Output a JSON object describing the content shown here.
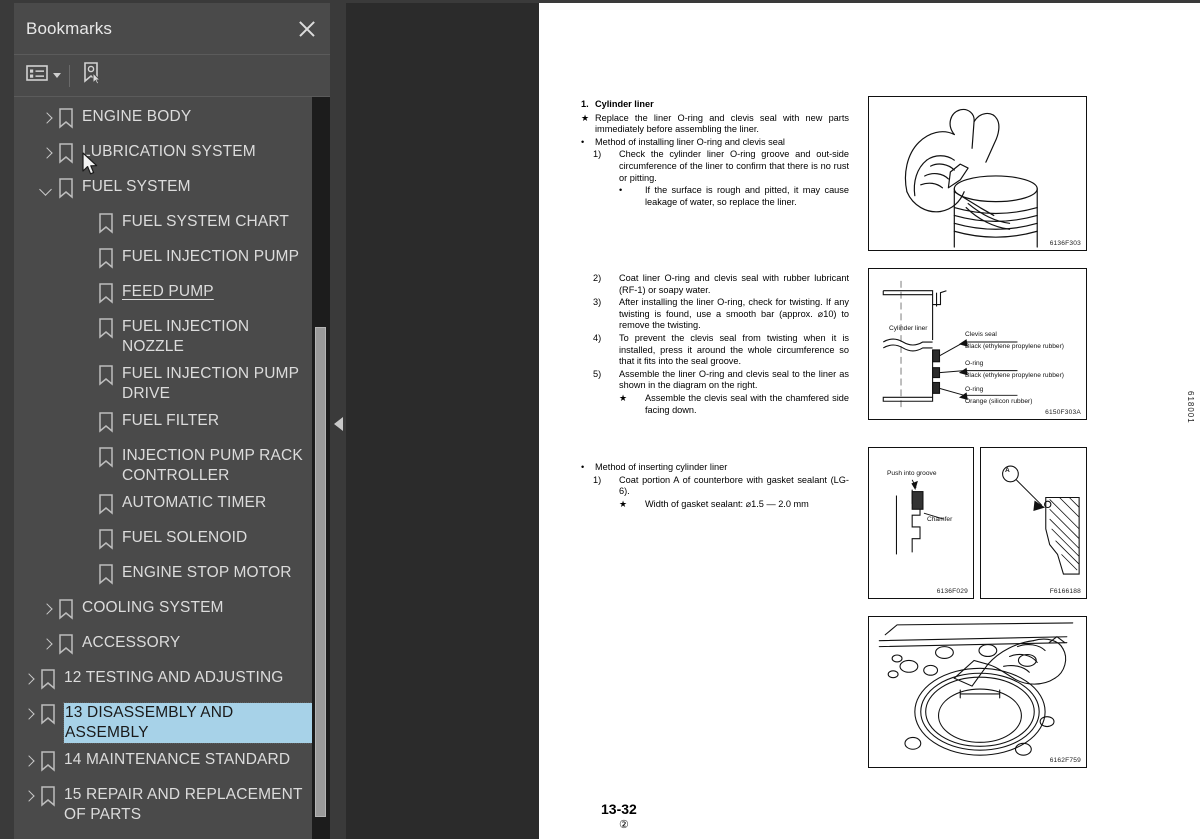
{
  "panel": {
    "title": "Bookmarks",
    "close_icon": "close-icon",
    "toolbar": {
      "options_icon": "list-options-icon",
      "chevron_icon": "chevron-down-icon",
      "new_bookmark_icon": "new-bookmark-icon"
    }
  },
  "tree": [
    {
      "label": "ENGINE BODY",
      "level": 0,
      "twisty": "right",
      "state": "normal"
    },
    {
      "label": "LUBRICATION SYSTEM",
      "level": 0,
      "twisty": "right",
      "state": "normal"
    },
    {
      "label": "FUEL SYSTEM",
      "level": 0,
      "twisty": "down",
      "state": "normal"
    },
    {
      "label": "FUEL SYSTEM CHART",
      "level": 1,
      "twisty": "none",
      "state": "normal"
    },
    {
      "label": "FUEL INJECTION PUMP",
      "level": 1,
      "twisty": "none",
      "state": "normal"
    },
    {
      "label": "FEED PUMP ",
      "level": 1,
      "twisty": "none",
      "state": "underlined"
    },
    {
      "label": "FUEL INJECTION NOZZLE",
      "level": 1,
      "twisty": "none",
      "state": "normal"
    },
    {
      "label": "FUEL INJECTION PUMP DRIVE",
      "level": 1,
      "twisty": "none",
      "state": "normal"
    },
    {
      "label": "FUEL FILTER",
      "level": 1,
      "twisty": "none",
      "state": "normal"
    },
    {
      "label": "INJECTION PUMP RACK CONTROLLER",
      "level": 1,
      "twisty": "none",
      "state": "normal"
    },
    {
      "label": "AUTOMATIC TIMER",
      "level": 1,
      "twisty": "none",
      "state": "normal"
    },
    {
      "label": "FUEL SOLENOID",
      "level": 1,
      "twisty": "none",
      "state": "normal"
    },
    {
      "label": "ENGINE STOP MOTOR",
      "level": 1,
      "twisty": "none",
      "state": "normal"
    },
    {
      "label": "COOLING SYSTEM",
      "level": 0,
      "twisty": "right",
      "state": "normal"
    },
    {
      "label": "ACCESSORY",
      "level": 0,
      "twisty": "right",
      "state": "normal"
    },
    {
      "label": "12 TESTING AND ADJUSTING",
      "level": -1,
      "twisty": "right",
      "state": "normal"
    },
    {
      "label": "13 DISASSEMBLY AND ASSEMBLY",
      "level": -1,
      "twisty": "right",
      "state": "selected"
    },
    {
      "label": "14 MAINTENANCE STANDARD",
      "level": -1,
      "twisty": "right",
      "state": "normal"
    },
    {
      "label": "15 REPAIR AND REPLACEMENT OF PARTS",
      "level": -1,
      "twisty": "right",
      "state": "normal"
    }
  ],
  "collapse_handle_icon": "collapse-left-arrow-icon",
  "document": {
    "page_number": "13-32",
    "page_revision": "②",
    "side_code": "618001",
    "block1": {
      "heading_num": "1.",
      "heading": "Cylinder liner",
      "l1_mark": "★",
      "l1": "Replace the liner O-ring and clevis seal with new parts immediately before assembling the liner.",
      "l2_mark": "•",
      "l2": "Method of installing liner O-ring and clevis seal",
      "l3_mark": "1)",
      "l3": "Check the cylinder liner O-ring groove and out-side circumference of the liner to confirm that there is no rust or pitting.",
      "l4_mark": "•",
      "l4": "If the surface is rough and pitted, it may cause leakage of water, so replace the liner."
    },
    "block2": {
      "i2_mark": "2)",
      "i2": "Coat liner O-ring and clevis seal with rubber lubricant (RF-1) or soapy water.",
      "i3_mark": "3)",
      "i3": "After installing the liner O-ring, check for twisting. If any twisting is found, use a smooth bar (approx. ⌀10) to remove the twisting.",
      "i4_mark": "4)",
      "i4": "To prevent the clevis seal from twisting when it is installed, press it around the whole circumference so that it fits into the seal groove.",
      "i5_mark": "5)",
      "i5": "Assemble the liner O-ring and clevis seal to the liner as shown in the diagram on the right.",
      "i6_mark": "★",
      "i6": "Assemble the clevis seal with the chamfered side facing down."
    },
    "block3": {
      "j1_mark": "•",
      "j1": "Method of inserting cylinder liner",
      "j2_mark": "1)",
      "j2": "Coat portion A of counterbore with gasket sealant (LG-6).",
      "j3_mark": "★",
      "j3": "Width of gasket sealant: ⌀1.5 — 2.0 mm"
    },
    "figures": [
      {
        "id": "6136F303",
        "caption": "hand-installing-o-ring-on-liner"
      },
      {
        "id": "6150F303A",
        "caption": "cylinder-liner-cross-section",
        "labels": [
          "Cylinder liner",
          "Clevis seal",
          "Black (ethylene propylene rubber)",
          "O-ring",
          "Black  (ethylene propylene rubber)",
          "O-ring",
          "Orange (silicon rubber)"
        ]
      },
      {
        "id": "6136F029",
        "caption": "push-into-groove-chamfer",
        "labels": [
          "Push into groove",
          "Chamfer"
        ]
      },
      {
        "id": "F6166188",
        "caption": "counterbore-portion-a-detail",
        "labels": [
          "A"
        ]
      },
      {
        "id": "6162F759",
        "caption": "hand-applying-sealant-to-counterbore"
      }
    ]
  }
}
